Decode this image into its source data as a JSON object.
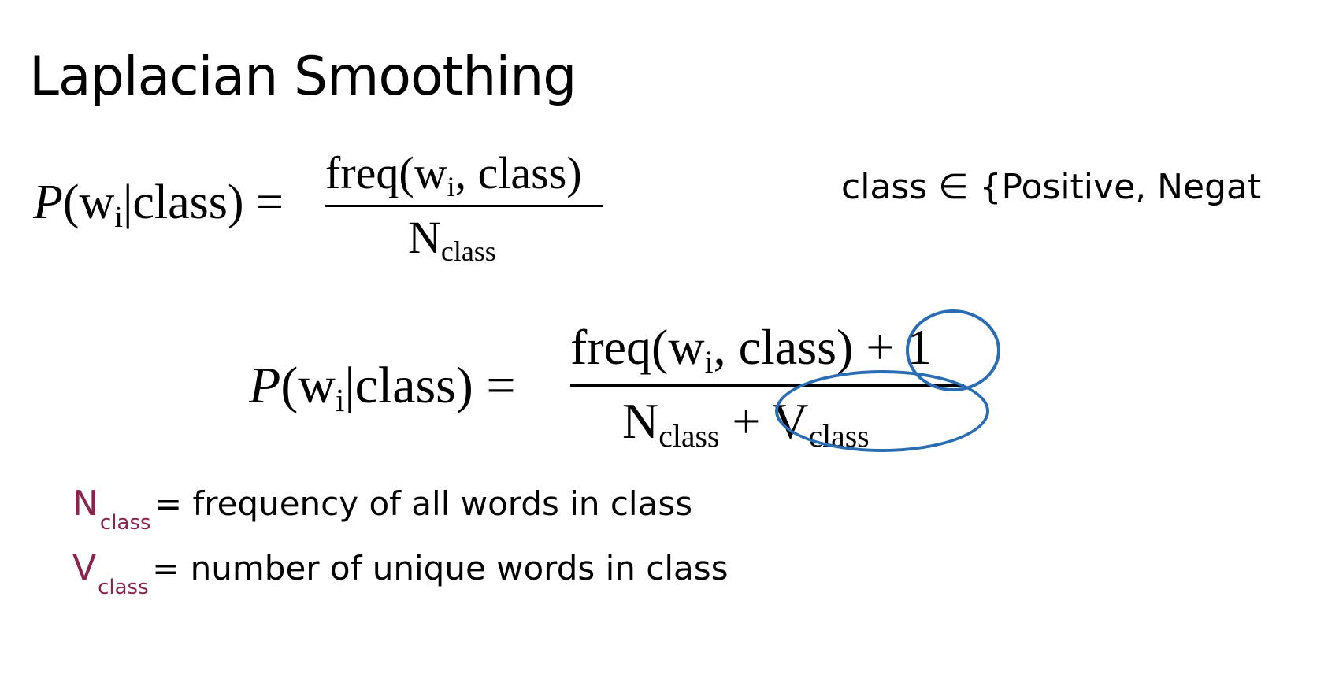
{
  "title": "Laplacian Smoothing",
  "formula1": {
    "lhs_P": "P",
    "lhs_open": "(w",
    "lhs_i": "i",
    "lhs_rest": "|class) =",
    "num_main": "freq(w",
    "num_i": "i",
    "num_rest": ", class)",
    "den_main": "N",
    "den_sub": "class"
  },
  "class_set": "class ∈ {Positive, Negat",
  "formula2": {
    "lhs_P": "P",
    "lhs_open": "(w",
    "lhs_i": "i",
    "lhs_rest": "|class) =",
    "num_main": "freq(w",
    "num_i": "i",
    "num_rest": ", class) + 1",
    "den_N": "N",
    "den_N_sub": "class",
    "den_plus": " + ",
    "den_V": "V",
    "den_V_sub": "class"
  },
  "definitions": [
    {
      "var": "N",
      "sub": "class",
      "text": "= frequency of all words in class"
    },
    {
      "var": "V",
      "sub": "class",
      "text": "= number of unique words in class"
    }
  ],
  "colors": {
    "definition_var": "#8a2450",
    "annotation": "#2a6db3"
  }
}
